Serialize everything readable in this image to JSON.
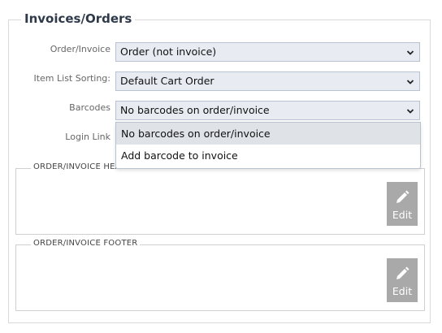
{
  "panel": {
    "title": "Invoices/Orders"
  },
  "fields": {
    "order_invoice": {
      "label": "Order/Invoice",
      "value": "Order (not invoice)"
    },
    "item_list_sorting": {
      "label": "Item List Sorting:",
      "value": "Default Cart Order"
    },
    "barcodes": {
      "label": "Barcodes",
      "value": "No barcodes on order/invoice",
      "options": [
        "No barcodes on order/invoice",
        "Add barcode to invoice"
      ]
    },
    "login_link": {
      "label": "Login Link"
    }
  },
  "header_section": {
    "title": "ORDER/INVOICE HEADER",
    "edit_label": "Edit"
  },
  "footer_section": {
    "title": "ORDER/INVOICE FOOTER",
    "edit_label": "Edit"
  }
}
